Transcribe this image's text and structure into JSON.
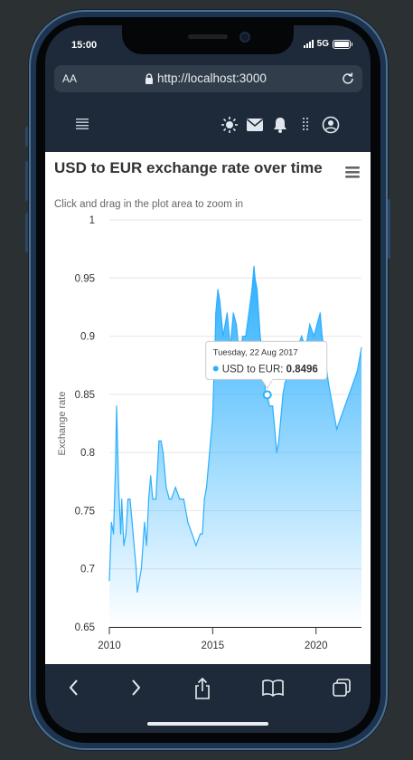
{
  "status_bar": {
    "time": "15:00",
    "network": "5G"
  },
  "browser": {
    "text_size_label": "AA",
    "url": "http://localhost:3000",
    "icons": {
      "lock": "lock-icon",
      "reload": "reload-icon"
    }
  },
  "app_bar": {
    "icons": [
      "menu-icon",
      "brightness-icon",
      "mail-icon",
      "bell-icon",
      "apps-icon",
      "account-icon"
    ]
  },
  "chart": {
    "title": "USD to EUR exchange rate over time",
    "subtitle": "Click and drag in the plot area to zoom in",
    "menu_icon": "hamburger-menu-icon",
    "tooltip": {
      "date": "Tuesday, 22 Aug 2017",
      "series": "USD to EUR",
      "separator": ": ",
      "value": "0.8496"
    }
  },
  "chart_data": {
    "type": "area",
    "title": "USD to EUR exchange rate over time",
    "subtitle": "Click and drag in the plot area to zoom in",
    "xlabel": "",
    "ylabel": "Exchange rate",
    "ylim": [
      0.65,
      1
    ],
    "xlim": [
      2010.0,
      2022.2
    ],
    "y_ticks": [
      "0.65",
      "0.7",
      "0.75",
      "0.8",
      "0.85",
      "0.9",
      "0.95",
      "1"
    ],
    "x_ticks": [
      "2010",
      "2015",
      "2020"
    ],
    "grid": true,
    "legend": "none",
    "color": "#2caffe",
    "series": [
      {
        "name": "USD to EUR",
        "x": [
          2010.0,
          2010.1,
          2010.2,
          2010.3,
          2010.35,
          2010.45,
          2010.55,
          2010.6,
          2010.7,
          2010.8,
          2010.9,
          2011.0,
          2011.1,
          2011.2,
          2011.3,
          2011.35,
          2011.45,
          2011.55,
          2011.7,
          2011.8,
          2011.9,
          2012.0,
          2012.1,
          2012.25,
          2012.4,
          2012.5,
          2012.6,
          2012.75,
          2012.9,
          2013.0,
          2013.2,
          2013.4,
          2013.6,
          2013.8,
          2014.0,
          2014.2,
          2014.4,
          2014.5,
          2014.6,
          2014.7,
          2014.85,
          2015.0,
          2015.05,
          2015.1,
          2015.15,
          2015.25,
          2015.35,
          2015.5,
          2015.7,
          2015.85,
          2016.0,
          2016.15,
          2016.3,
          2016.45,
          2016.6,
          2016.75,
          2016.9,
          2017.0,
          2017.05,
          2017.15,
          2017.3,
          2017.45,
          2017.55,
          2017.64,
          2017.75,
          2017.9,
          2018.0,
          2018.1,
          2018.2,
          2018.3,
          2018.4,
          2018.5,
          2018.7,
          2018.9,
          2019.1,
          2019.3,
          2019.5,
          2019.7,
          2019.9,
          2020.05,
          2020.2,
          2020.3,
          2020.45,
          2020.6,
          2020.8,
          2021.0,
          2021.2,
          2021.4,
          2021.6,
          2021.8,
          2022.0,
          2022.2
        ],
        "y": [
          0.69,
          0.74,
          0.73,
          0.79,
          0.84,
          0.77,
          0.73,
          0.76,
          0.72,
          0.73,
          0.76,
          0.76,
          0.74,
          0.72,
          0.7,
          0.68,
          0.69,
          0.7,
          0.74,
          0.72,
          0.76,
          0.78,
          0.76,
          0.76,
          0.81,
          0.81,
          0.8,
          0.77,
          0.76,
          0.76,
          0.77,
          0.76,
          0.76,
          0.74,
          0.73,
          0.72,
          0.73,
          0.73,
          0.76,
          0.77,
          0.8,
          0.83,
          0.86,
          0.88,
          0.92,
          0.94,
          0.93,
          0.9,
          0.92,
          0.89,
          0.92,
          0.91,
          0.88,
          0.9,
          0.9,
          0.92,
          0.94,
          0.96,
          0.95,
          0.94,
          0.9,
          0.88,
          0.85,
          0.8496,
          0.84,
          0.84,
          0.82,
          0.8,
          0.81,
          0.83,
          0.85,
          0.86,
          0.87,
          0.88,
          0.89,
          0.9,
          0.89,
          0.91,
          0.9,
          0.91,
          0.92,
          0.9,
          0.88,
          0.86,
          0.84,
          0.82,
          0.83,
          0.84,
          0.85,
          0.86,
          0.87,
          0.89
        ]
      }
    ]
  }
}
